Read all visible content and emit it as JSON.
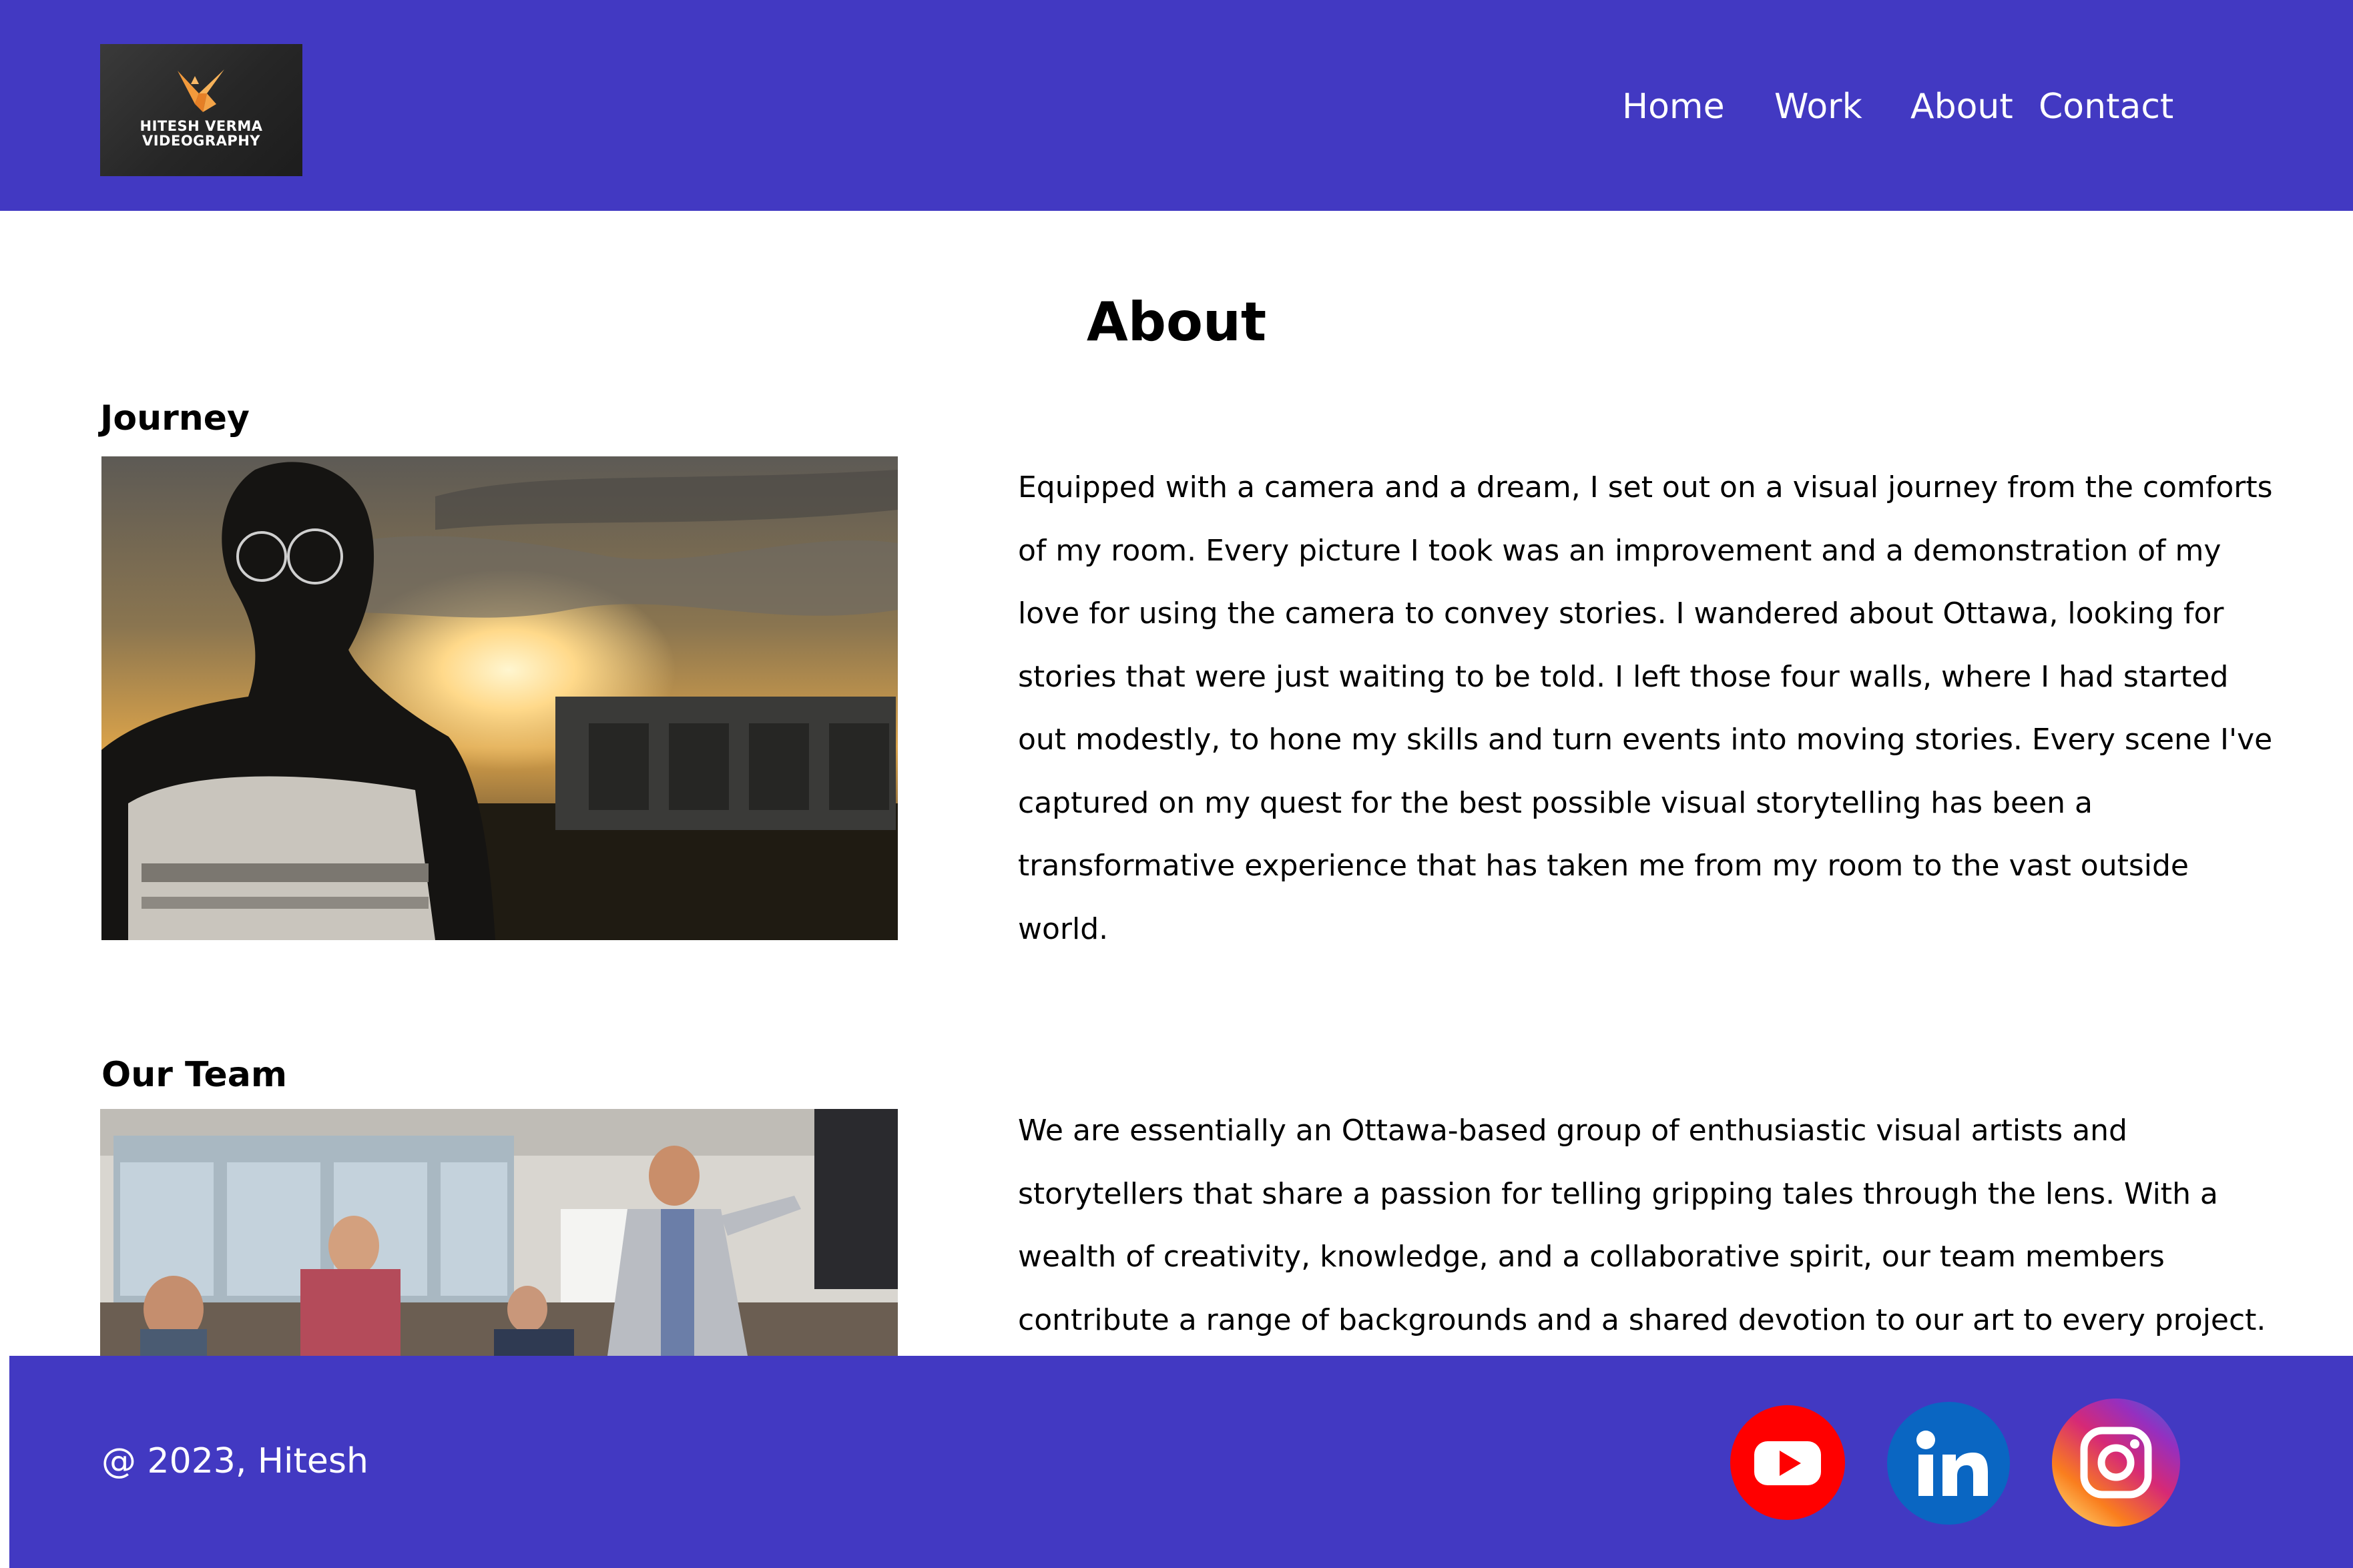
{
  "header": {
    "logo": {
      "line1": "HITESH VERMA",
      "line2": "VIDEOGRAPHY"
    },
    "nav": [
      "Home",
      "Work",
      "About",
      "Contact"
    ]
  },
  "main": {
    "title": "About",
    "sections": [
      {
        "heading": "Journey",
        "image": "portrait-sunset-photo",
        "text": "Equipped with a camera and a dream, I set out on a visual journey from the comforts of my room. Every picture I took was an improvement and a demonstration of my love for using the camera to convey stories. I wandered about Ottawa, looking for stories that were just waiting to be told. I left those four walls, where I had started out modestly, to hone my skills and turn events into moving stories. Every scene I've captured on my quest for the best possible visual storytelling has been a transformative experience that has taken me from my room to the vast outside world."
      },
      {
        "heading": "Our Team",
        "image": "team-office-photo",
        "text": "We are essentially an Ottawa-based group of enthusiastic visual artists and storytellers that share a passion for telling gripping tales through the lens. With a wealth of creativity, knowledge, and a collaborative spirit, our team members contribute a range of backgrounds and a shared devotion to our art to every project. Each member, from"
      }
    ]
  },
  "footer": {
    "copyright": "@ 2023, Hitesh",
    "social": [
      {
        "name": "YouTube",
        "icon": "youtube-icon",
        "color": "#ff0000"
      },
      {
        "name": "LinkedIn",
        "icon": "linkedin-icon",
        "color": "#0a66c2"
      },
      {
        "name": "Instagram",
        "icon": "instagram-icon",
        "color": "#d62976"
      }
    ]
  },
  "colors": {
    "brand": "#4239c2",
    "text": "#000000",
    "on_brand": "#ffffff"
  }
}
